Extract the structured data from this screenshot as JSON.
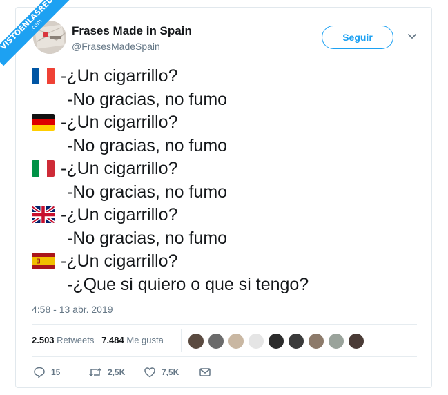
{
  "watermark": {
    "line1": "VISTOENLASREDES",
    "line2": ".com"
  },
  "author": {
    "avatar_icon": "profile-photo-map",
    "name": "Frases Made in Spain",
    "handle": "@FrasesMadeSpain"
  },
  "follow_label": "Seguir",
  "tweet_lines": [
    {
      "flag": "france",
      "text": "-¿Un cigarrillo?"
    },
    {
      "flag": null,
      "text": "-No gracias, no fumo"
    },
    {
      "flag": "germany",
      "text": "-¿Un cigarrillo?"
    },
    {
      "flag": null,
      "text": "-No gracias, no fumo"
    },
    {
      "flag": "italy",
      "text": "-¿Un cigarrillo?"
    },
    {
      "flag": null,
      "text": "-No gracias, no fumo"
    },
    {
      "flag": "united-kingdom",
      "text": "-¿Un cigarrillo?"
    },
    {
      "flag": null,
      "text": "-No gracias, no fumo"
    },
    {
      "flag": "spain",
      "text": "-¿Un cigarrillo?"
    },
    {
      "flag": null,
      "text": "-¿Que si quiero o que si tengo?"
    }
  ],
  "timestamp": "4:58 - 13 abr. 2019",
  "stats": {
    "retweets_count": "2.503",
    "retweets_label": "Retweets",
    "likes_count": "7.484",
    "likes_label": "Me gusta"
  },
  "liker_avatars": 9,
  "actions": {
    "reply_count": "15",
    "retweet_count": "2,5K",
    "like_count": "7,5K"
  },
  "colors": {
    "accent": "#1da1f2",
    "text": "#14171a",
    "muted": "#657786"
  }
}
